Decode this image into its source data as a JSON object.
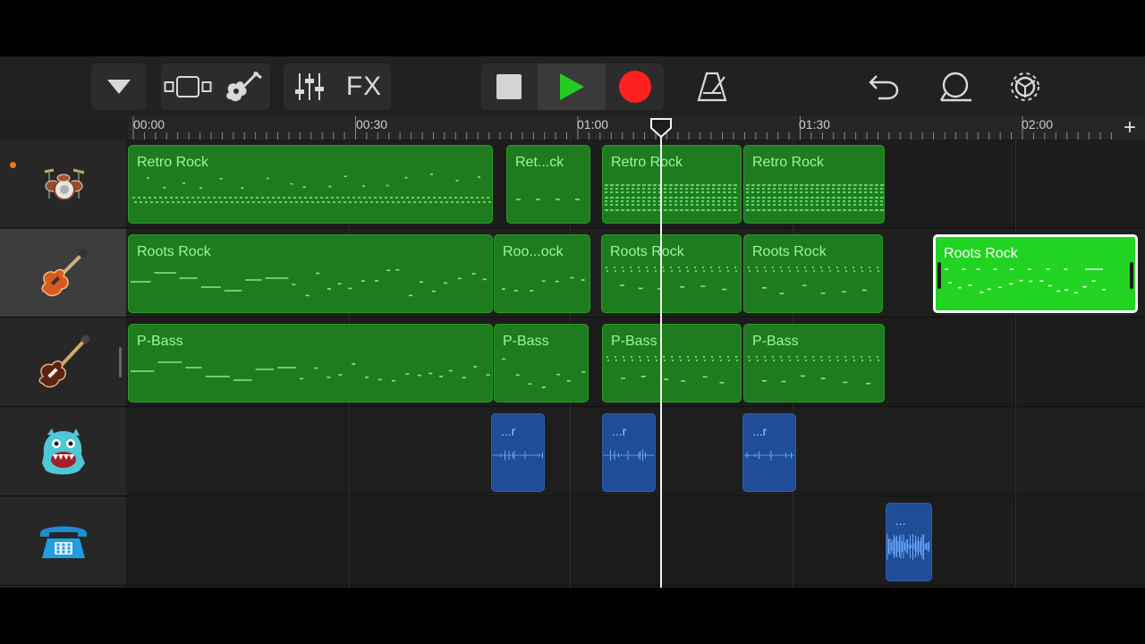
{
  "toolbar": {
    "fx_label": "FX"
  },
  "ruler": {
    "labels": [
      "00:00",
      "00:30",
      "01:00",
      "01:30",
      "02:00"
    ],
    "add_label": "+"
  },
  "tracks": [
    {
      "instrument": "drums-icon",
      "regions": [
        {
          "name": "Retro Rock"
        },
        {
          "name": "Ret...ck"
        },
        {
          "name": "Retro Rock"
        },
        {
          "name": "Retro Rock"
        }
      ]
    },
    {
      "instrument": "electric-guitar-icon",
      "regions": [
        {
          "name": "Roots Rock"
        },
        {
          "name": "Roo...ock"
        },
        {
          "name": "Roots Rock"
        },
        {
          "name": "Roots Rock"
        },
        {
          "name": "Roots Rock"
        }
      ]
    },
    {
      "instrument": "bass-guitar-icon",
      "regions": [
        {
          "name": "P-Bass"
        },
        {
          "name": "P-Bass"
        },
        {
          "name": "P-Bass"
        },
        {
          "name": "P-Bass"
        }
      ]
    },
    {
      "instrument": "monster-icon",
      "regions": [
        {
          "name": "...r"
        },
        {
          "name": "...r"
        },
        {
          "name": "...r"
        }
      ]
    },
    {
      "instrument": "telephone-icon",
      "regions": [
        {
          "name": "..."
        }
      ]
    }
  ],
  "colors": {
    "midi_region": "#1e7c1e",
    "midi_selected": "#22d422",
    "audio_region": "#1f4d96",
    "record": "#ff2020",
    "play": "#22cc22"
  }
}
